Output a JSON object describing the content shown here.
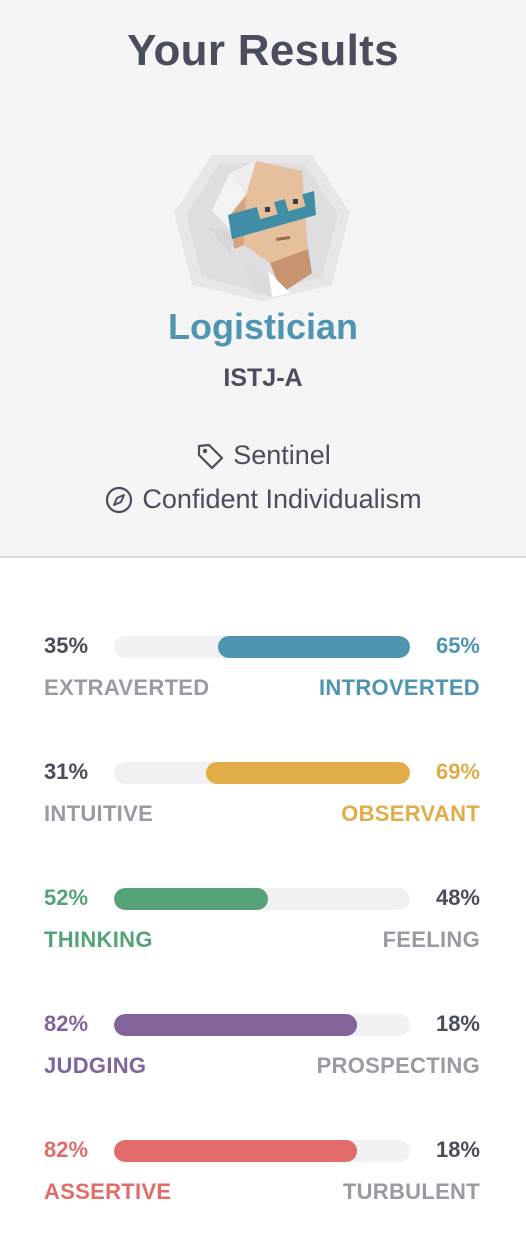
{
  "header": {
    "title": "Your Results",
    "type_name": "Logistician",
    "type_code": "ISTJ-A",
    "role": "Sentinel",
    "strategy": "Confident Individualism",
    "avatar_icon": "logistician-avatar-icon",
    "role_icon": "tag-icon",
    "strategy_icon": "compass-icon"
  },
  "traits": [
    {
      "left_pct": "35%",
      "right_pct": "65%",
      "left_label": "EXTRAVERTED",
      "right_label": "INTROVERTED",
      "dominant": "right",
      "color": "#4e95b1",
      "fill_fraction": 0.65
    },
    {
      "left_pct": "31%",
      "right_pct": "69%",
      "left_label": "INTUITIVE",
      "right_label": "OBSERVANT",
      "dominant": "right",
      "color": "#e2ac49",
      "fill_fraction": 0.69
    },
    {
      "left_pct": "52%",
      "right_pct": "48%",
      "left_label": "THINKING",
      "right_label": "FEELING",
      "dominant": "left",
      "color": "#56a378",
      "fill_fraction": 0.52
    },
    {
      "left_pct": "82%",
      "right_pct": "18%",
      "left_label": "JUDGING",
      "right_label": "PROSPECTING",
      "dominant": "left",
      "color": "#82639a",
      "fill_fraction": 0.82
    },
    {
      "left_pct": "82%",
      "right_pct": "18%",
      "left_label": "ASSERTIVE",
      "right_label": "TURBULENT",
      "dominant": "left",
      "color": "#e26c69",
      "fill_fraction": 0.82
    }
  ],
  "colors": {
    "muted": "#9a9aa4",
    "dark": "#4a4d5c"
  }
}
